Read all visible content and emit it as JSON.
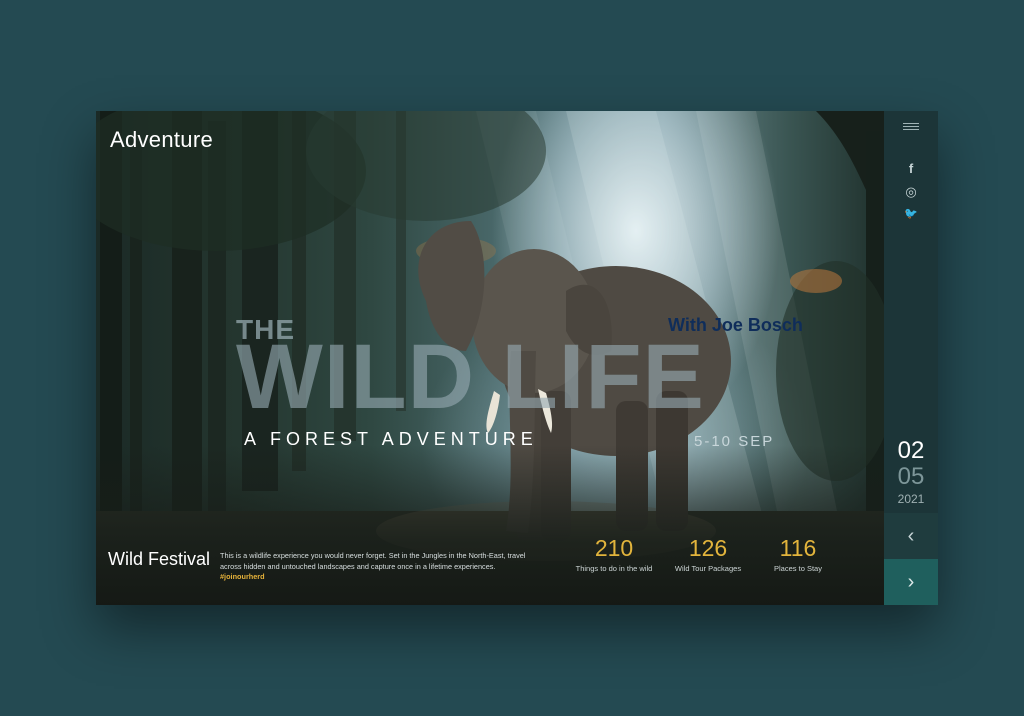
{
  "brand": "Adventure",
  "hero": {
    "title_small": "THE",
    "title_large": "WILD LIFE",
    "host": "With Joe Bosch",
    "subtitle": "A FOREST ADVENTURE",
    "dates": "5-10 SEP"
  },
  "festival": {
    "name": "Wild Festival",
    "description": "This is a wildlife experience you would never forget. Set in the Jungles in the North-East, travel across hidden and untouched landscapes and capture once in a lifetime experiences.",
    "hashtag": "#joinourherd"
  },
  "stats": [
    {
      "value": "210",
      "label": "Things to do in the wild"
    },
    {
      "value": "126",
      "label": "Wild Tour Packages"
    },
    {
      "value": "116",
      "label": "Places to Stay"
    }
  ],
  "sidebar": {
    "menu_icon": "hamburger-icon",
    "social": [
      {
        "name": "facebook-icon",
        "glyph": "f"
      },
      {
        "name": "instagram-icon",
        "glyph": "◎"
      },
      {
        "name": "twitter-icon",
        "glyph": "🐦"
      }
    ],
    "slide_current": "02",
    "slide_total": "05",
    "year": "2021",
    "prev_glyph": "‹",
    "next_glyph": "›"
  },
  "colors": {
    "background": "#244a52",
    "accent_gold": "#e2b43c",
    "host_blue": "#0f2d5a",
    "sidebar": "#1c3538",
    "next_button": "#1f5f5d"
  }
}
